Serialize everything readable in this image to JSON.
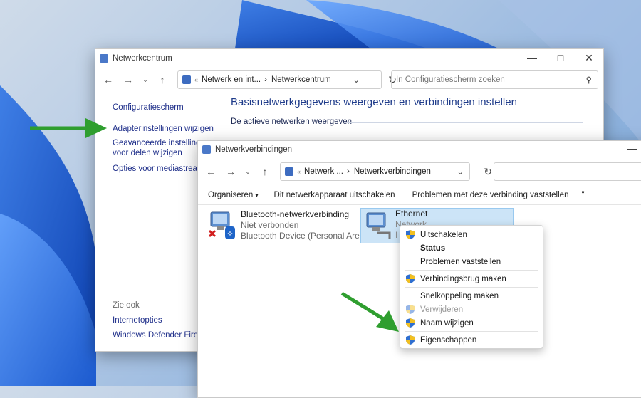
{
  "control_panel": {
    "title": "Netwerkcentrum",
    "breadcrumb_root": "Netwerk en int...",
    "breadcrumb_current": "Netwerkcentrum",
    "search_placeholder": "In Configuratiescherm zoeken",
    "sidebar": {
      "links": [
        "Configuratiescherm",
        "Adapterinstellingen wijzigen",
        "Geavanceerde instellingen",
        "voor delen wijzigen",
        "Opties voor mediastreaming"
      ],
      "see_also_label": "Zie ook",
      "see_also": [
        "Internetopties",
        "Windows Defender Firewall"
      ]
    },
    "main_heading": "Basisnetwerkgegevens weergeven en verbindingen instellen",
    "section_label": "De actieve netwerken weergeven"
  },
  "network_connections": {
    "title": "Netwerkverbindingen",
    "breadcrumb_root": "Netwerk ...",
    "breadcrumb_current": "Netwerkverbindingen",
    "commands": [
      "Organiseren",
      "Dit netwerkapparaat uitschakelen",
      "Problemen met deze verbinding vaststellen",
      "\""
    ],
    "connections": [
      {
        "name": "Bluetooth-netwerkverbinding",
        "status": "Niet verbonden",
        "device": "Bluetooth Device (Personal Area ..."
      },
      {
        "name": "Ethernet",
        "status": "Network",
        "device": "I"
      }
    ]
  },
  "context_menu": {
    "items": [
      {
        "label": "Uitschakelen",
        "shield": true
      },
      {
        "label": "Status",
        "bold": true
      },
      {
        "label": "Problemen vaststellen"
      },
      {
        "label": "Verbindingsbrug maken",
        "shield": true
      },
      {
        "label": "Snelkoppeling maken"
      },
      {
        "label": "Verwijderen",
        "shield": true,
        "disabled": true
      },
      {
        "label": "Naam wijzigen",
        "shield": true
      },
      {
        "label": "Eigenschappen",
        "shield": true
      }
    ]
  },
  "colors": {
    "accent_arrow": "#2f9e2f",
    "selection": "#cce4f7",
    "link": "#1f2f8a"
  }
}
